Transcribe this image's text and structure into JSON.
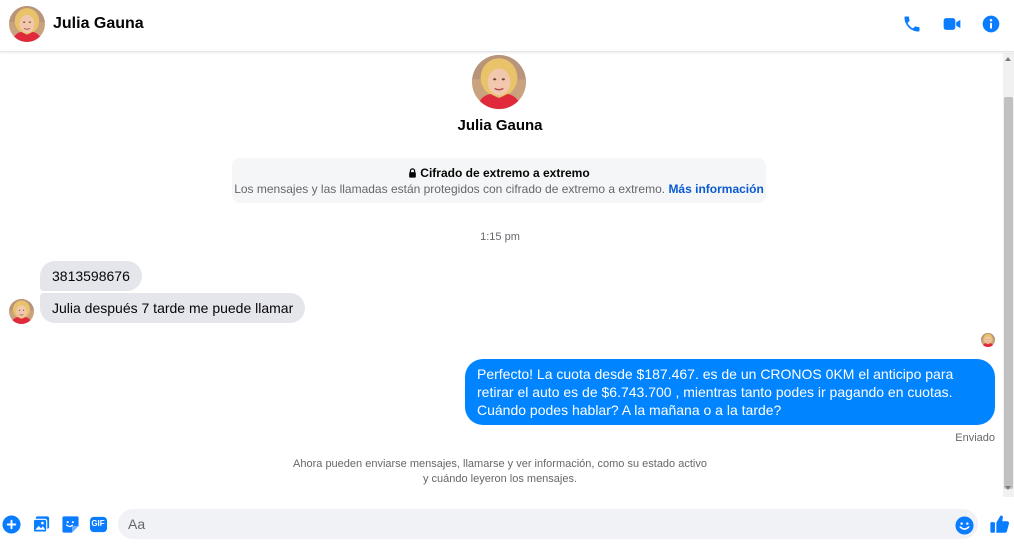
{
  "header": {
    "contact_name": "Julia Gauna",
    "icons": [
      "phone-icon",
      "video-camera-icon",
      "info-icon"
    ]
  },
  "profile": {
    "name": "Julia Gauna"
  },
  "encryption": {
    "title": "Cifrado de extremo a extremo",
    "description": "Los mensajes y las llamadas están protegidos con cifrado de extremo a extremo.",
    "link": "Más información"
  },
  "conversation": {
    "timestamp": "1:15 pm",
    "incoming": [
      "3813598676",
      "Julia después 7 tarde me puede llamar"
    ],
    "outgoing": "Perfecto! La cuota desde $187.467. es de un CRONOS 0KM el anticipo para retirar el auto es de $6.743.700 , mientras tanto podes ir pagando en cuotas. Cuándo podes hablar? A la mañana o a la tarde?",
    "sent_status": "Enviado",
    "notice_line1": "Ahora pueden enviarse mensajes, llamarse y ver información, como su estado activo",
    "notice_line2": "y cuándo leyeron los mensajes."
  },
  "composer": {
    "placeholder": "Aa",
    "icons": [
      "plus-icon",
      "image-icon",
      "sticker-icon",
      "gif-icon",
      "emoji-icon",
      "thumbs-up-icon"
    ],
    "gif_label": "GIF"
  },
  "colors": {
    "accent": "#0084ff",
    "incoming_bubble": "#e4e6eb",
    "icon_blue": "#0a7cff"
  }
}
